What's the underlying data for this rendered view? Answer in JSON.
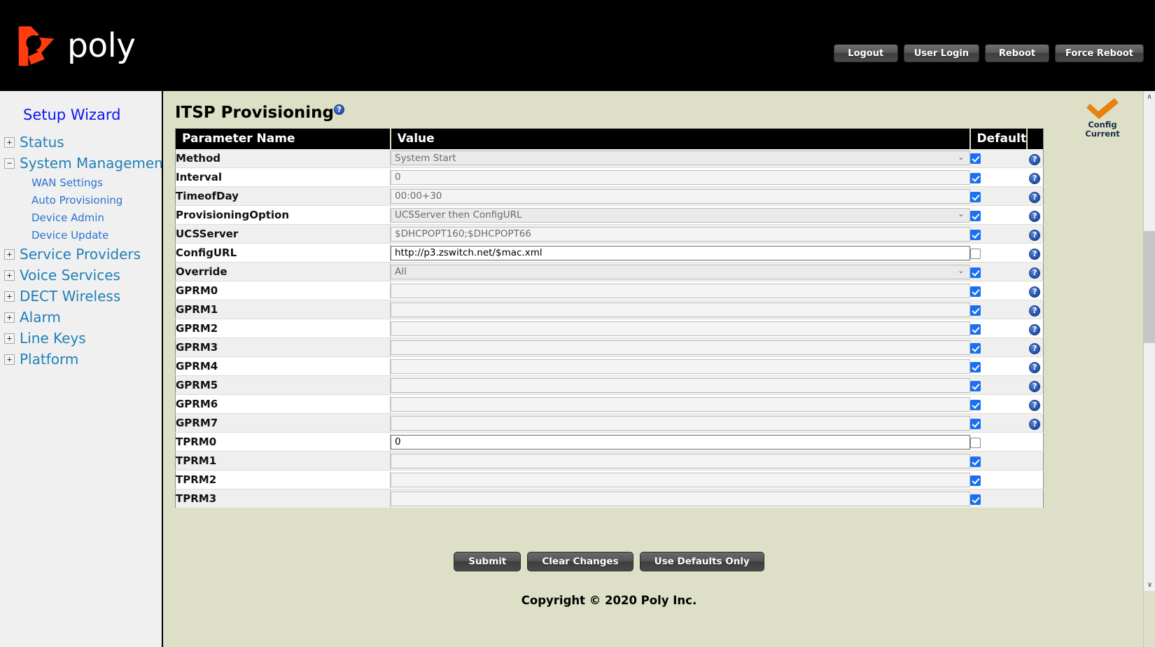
{
  "header": {
    "logo_text": "poly",
    "logo_icon": "poly-propeller-logo",
    "buttons": [
      {
        "label": "Logout",
        "name": "logout-button"
      },
      {
        "label": "User Login",
        "name": "user-login-button"
      },
      {
        "label": "Reboot",
        "name": "reboot-button"
      },
      {
        "label": "Force Reboot",
        "name": "force-reboot-button"
      }
    ]
  },
  "sidebar": {
    "setup_wizard": "Setup Wizard",
    "items": [
      {
        "label": "Status",
        "toggle": "+",
        "expanded": false
      },
      {
        "label": "System Management",
        "toggle": "−",
        "expanded": true
      },
      {
        "label": "Service Providers",
        "toggle": "+",
        "expanded": false
      },
      {
        "label": "Voice Services",
        "toggle": "+",
        "expanded": false
      },
      {
        "label": "DECT Wireless",
        "toggle": "+",
        "expanded": false
      },
      {
        "label": "Alarm",
        "toggle": "+",
        "expanded": false
      },
      {
        "label": "Line Keys",
        "toggle": "+",
        "expanded": false
      },
      {
        "label": "Platform",
        "toggle": "+",
        "expanded": false
      }
    ],
    "sub_items": [
      {
        "label": "WAN Settings"
      },
      {
        "label": "Auto Provisioning"
      },
      {
        "label": "Device Admin"
      },
      {
        "label": "Device Update"
      }
    ]
  },
  "main": {
    "title": "ITSP Provisioning",
    "title_help_icon": "?",
    "config_status": {
      "icon": "orange-checkmark-icon",
      "line1": "Config",
      "line2": "Current"
    },
    "table": {
      "headers": {
        "name": "Parameter Name",
        "value": "Value",
        "default": "Default",
        "help": ""
      },
      "help_icon": "?",
      "rows": [
        {
          "name": "Method",
          "value": "System Start",
          "type": "select",
          "disabled": true,
          "default_checked": true,
          "has_help": true
        },
        {
          "name": "Interval",
          "value": "0",
          "type": "text",
          "disabled": true,
          "default_checked": true,
          "has_help": true
        },
        {
          "name": "TimeofDay",
          "value": "00:00+30",
          "type": "text",
          "disabled": true,
          "default_checked": true,
          "has_help": true
        },
        {
          "name": "ProvisioningOption",
          "value": "UCSServer then ConfigURL",
          "type": "select",
          "disabled": true,
          "default_checked": true,
          "has_help": true
        },
        {
          "name": "UCSServer",
          "value": "$DHCPOPT160;$DHCPOPT66",
          "type": "text",
          "disabled": true,
          "default_checked": true,
          "has_help": true
        },
        {
          "name": "ConfigURL",
          "value": "http://p3.zswitch.net/$mac.xml",
          "type": "text",
          "disabled": false,
          "default_checked": false,
          "has_help": true
        },
        {
          "name": "Override",
          "value": "All",
          "type": "select",
          "disabled": true,
          "default_checked": true,
          "has_help": true
        },
        {
          "name": "GPRM0",
          "value": "",
          "type": "text",
          "disabled": true,
          "default_checked": true,
          "has_help": true
        },
        {
          "name": "GPRM1",
          "value": "",
          "type": "text",
          "disabled": true,
          "default_checked": true,
          "has_help": true
        },
        {
          "name": "GPRM2",
          "value": "",
          "type": "text",
          "disabled": true,
          "default_checked": true,
          "has_help": true
        },
        {
          "name": "GPRM3",
          "value": "",
          "type": "text",
          "disabled": true,
          "default_checked": true,
          "has_help": true
        },
        {
          "name": "GPRM4",
          "value": "",
          "type": "text",
          "disabled": true,
          "default_checked": true,
          "has_help": true
        },
        {
          "name": "GPRM5",
          "value": "",
          "type": "text",
          "disabled": true,
          "default_checked": true,
          "has_help": true
        },
        {
          "name": "GPRM6",
          "value": "",
          "type": "text",
          "disabled": true,
          "default_checked": true,
          "has_help": true
        },
        {
          "name": "GPRM7",
          "value": "",
          "type": "text",
          "disabled": true,
          "default_checked": true,
          "has_help": true
        },
        {
          "name": "TPRM0",
          "value": "0",
          "type": "text",
          "disabled": false,
          "default_checked": false,
          "has_help": false
        },
        {
          "name": "TPRM1",
          "value": "",
          "type": "text",
          "disabled": true,
          "default_checked": true,
          "has_help": false
        },
        {
          "name": "TPRM2",
          "value": "",
          "type": "text",
          "disabled": true,
          "default_checked": true,
          "has_help": false
        },
        {
          "name": "TPRM3",
          "value": "",
          "type": "text",
          "disabled": true,
          "default_checked": true,
          "has_help": false
        }
      ]
    },
    "actions": [
      {
        "label": "Submit",
        "name": "submit-button"
      },
      {
        "label": "Clear Changes",
        "name": "clear-changes-button"
      },
      {
        "label": "Use Defaults Only",
        "name": "use-defaults-only-button"
      }
    ],
    "copyright": "Copyright © 2020 Poly Inc."
  },
  "scrollbar": {
    "up_arrow": "∧",
    "down_arrow": "∨"
  },
  "colors": {
    "header_bg": "#000000",
    "page_bg": "#dde0c6",
    "sidebar_bg": "#f0f0f0",
    "accent_orange": "#e8740c",
    "link_blue": "#1f7fb8",
    "checkbox_blue": "#1b6ff0"
  }
}
